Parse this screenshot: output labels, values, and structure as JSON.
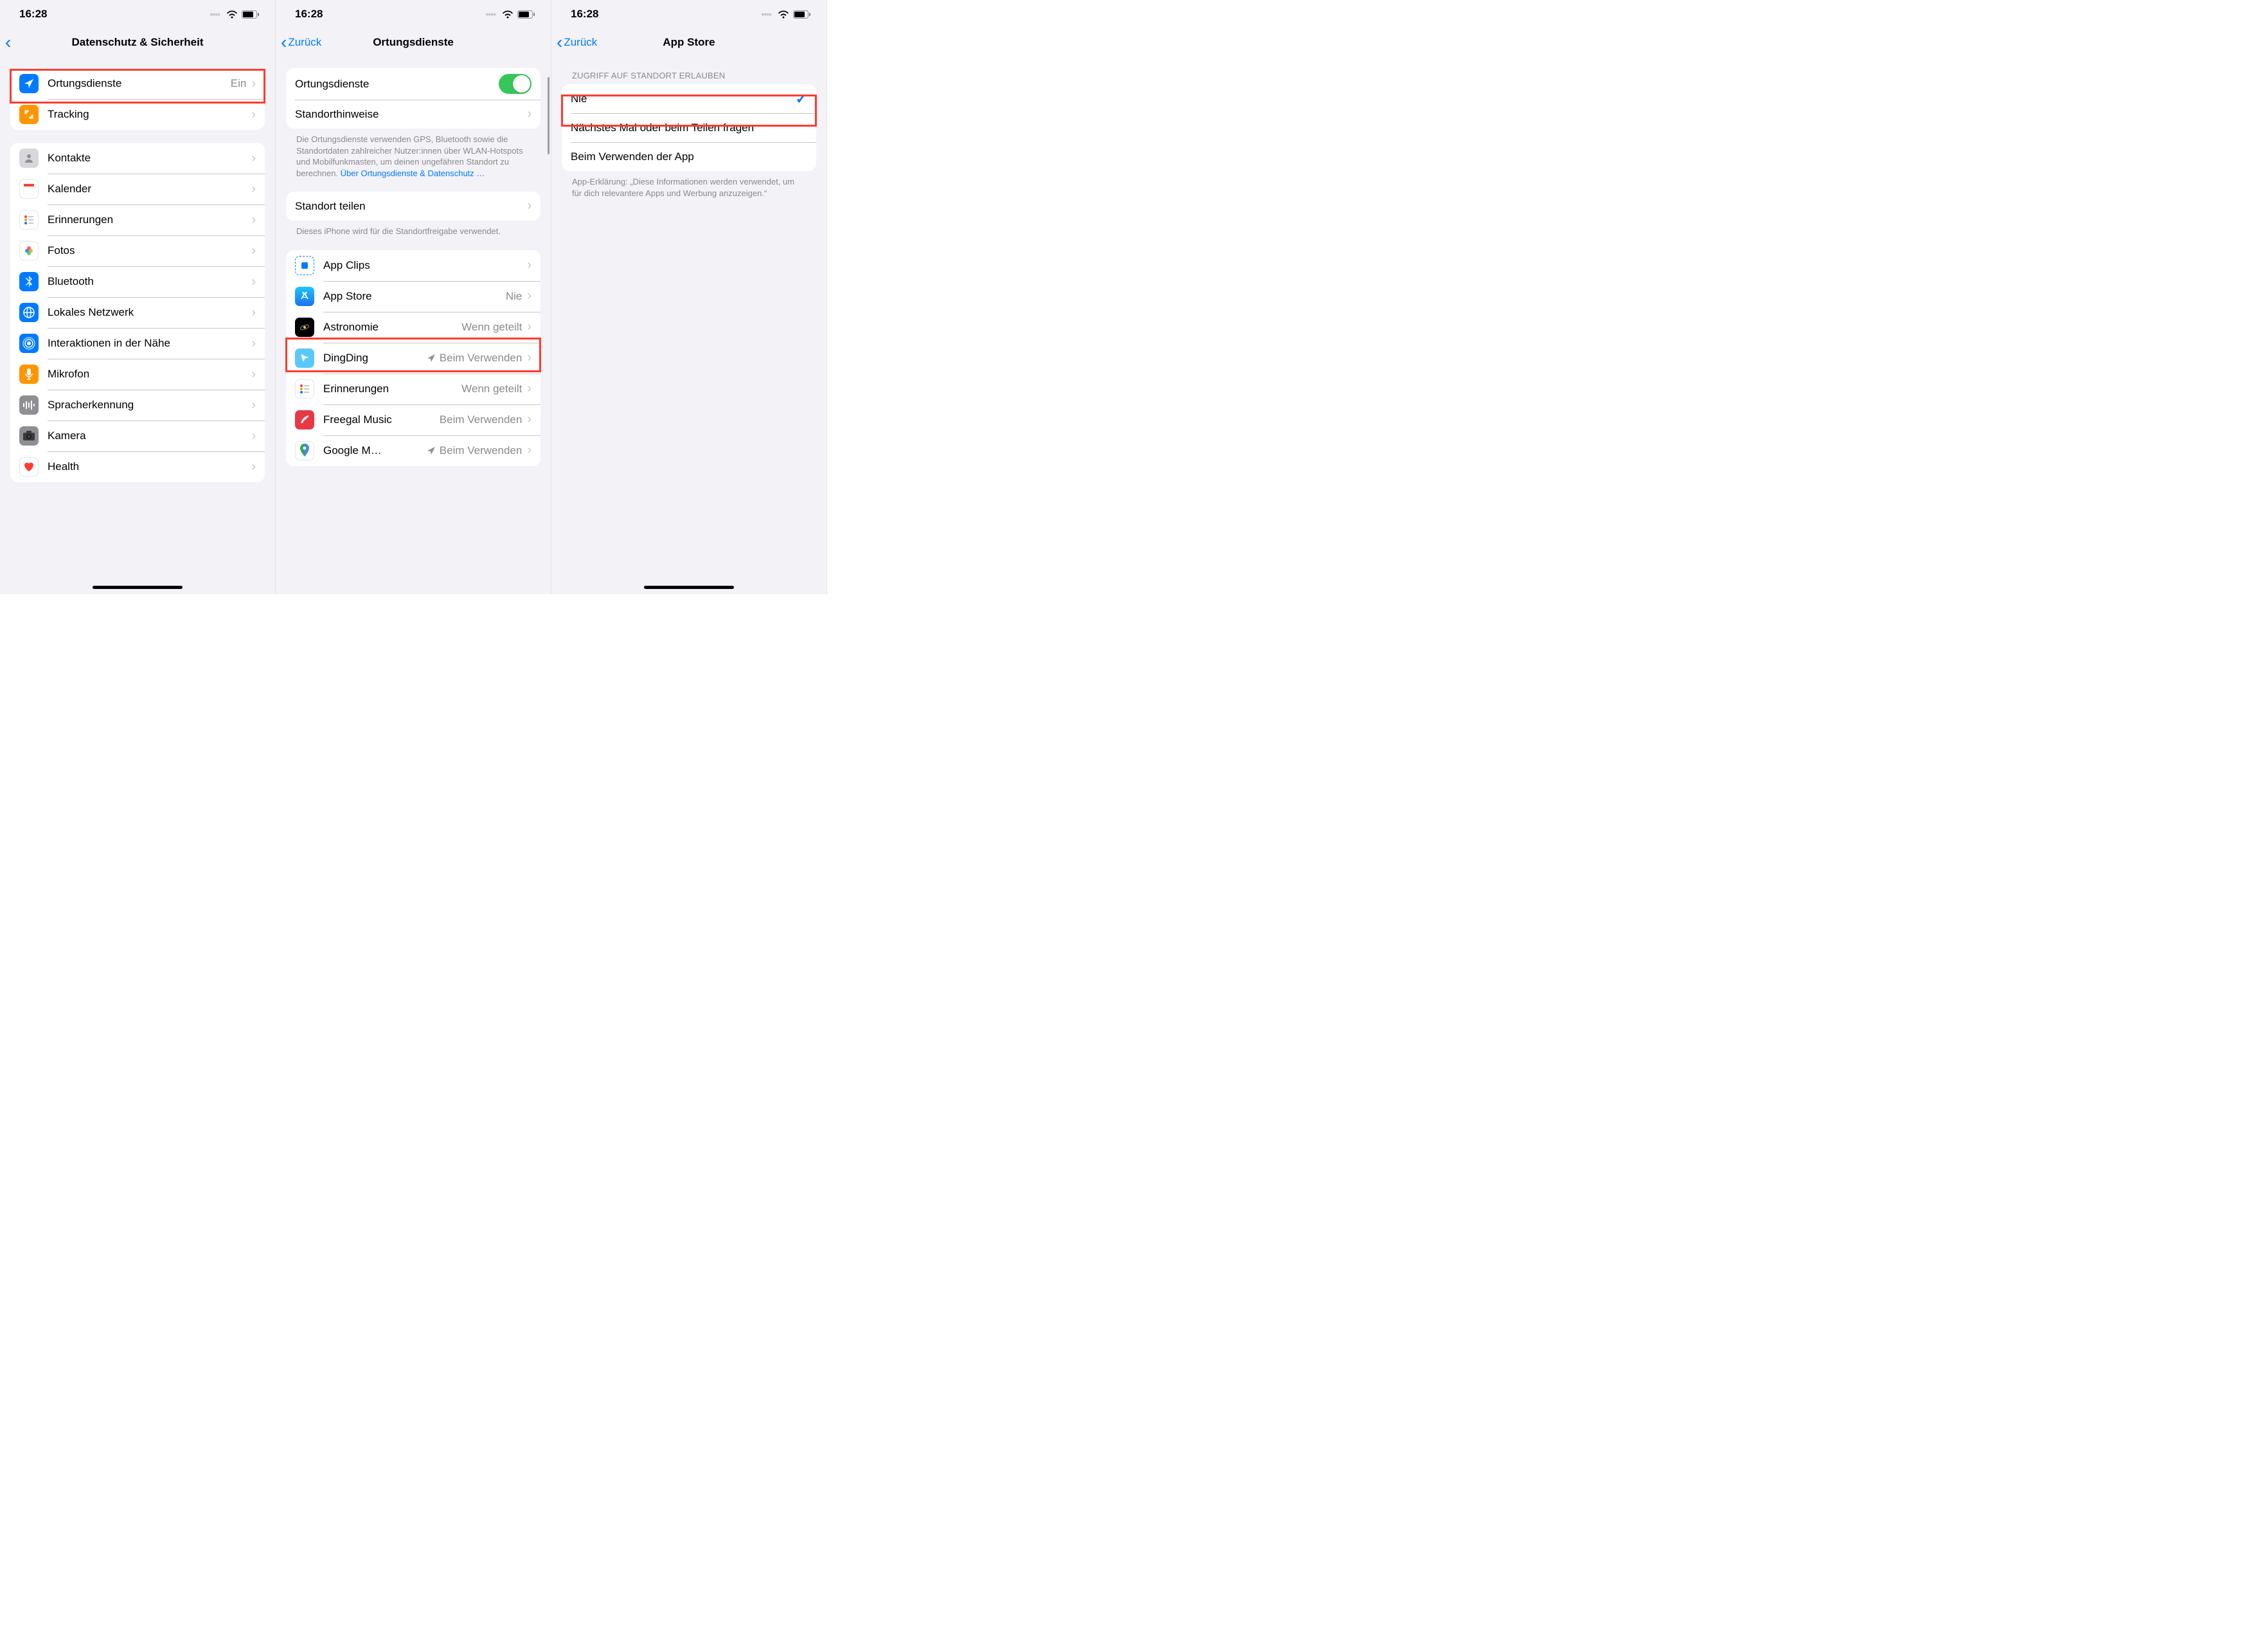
{
  "status": {
    "time": "16:28"
  },
  "screens": [
    {
      "back_label": "",
      "title": "Datenschutz & Sicherheit",
      "groups": [
        {
          "rows": [
            {
              "label": "Ortungsdienste",
              "value": "Ein"
            },
            {
              "label": "Tracking"
            }
          ]
        },
        {
          "rows": [
            {
              "label": "Kontakte"
            },
            {
              "label": "Kalender"
            },
            {
              "label": "Erinnerungen"
            },
            {
              "label": "Fotos"
            },
            {
              "label": "Bluetooth"
            },
            {
              "label": "Lokales Netzwerk"
            },
            {
              "label": "Interaktionen in der Nähe"
            },
            {
              "label": "Mikrofon"
            },
            {
              "label": "Spracherkennung"
            },
            {
              "label": "Kamera"
            },
            {
              "label": "Health"
            }
          ]
        }
      ]
    },
    {
      "back_label": "Zurück",
      "title": "Ortungsdienste",
      "groups": [
        {
          "rows": [
            {
              "label": "Ortungsdienste",
              "toggle": true
            },
            {
              "label": "Standorthinweise"
            }
          ],
          "footer": "Die Ortungsdienste verwenden GPS, Bluetooth sowie die Standortdaten zahlreicher Nutzer:innen über WLAN-Hotspots und Mobilfunkmasten, um deinen ungefähren Standort zu berechnen. ",
          "footer_link": "Über Ortungsdienste & Datenschutz …"
        },
        {
          "rows": [
            {
              "label": "Standort teilen"
            }
          ],
          "footer": "Dieses iPhone wird für die Standortfreigabe verwendet."
        },
        {
          "rows": [
            {
              "label": "App Clips"
            },
            {
              "label": "App Store",
              "value": "Nie"
            },
            {
              "label": "Astronomie",
              "value": "Wenn geteilt"
            },
            {
              "label": "DingDing",
              "value": "Beim Verwenden",
              "status_icon": true
            },
            {
              "label": "Erinnerungen",
              "value": "Wenn geteilt"
            },
            {
              "label": "Freegal Music",
              "value": "Beim Verwenden"
            },
            {
              "label": "Google M…",
              "value": "Beim Verwenden",
              "status_icon": true
            }
          ]
        }
      ]
    },
    {
      "back_label": "Zurück",
      "title": "App Store",
      "section_header": "ZUGRIFF AUF STANDORT ERLAUBEN",
      "options": [
        {
          "label": "Nie",
          "selected": true
        },
        {
          "label": "Nächstes Mal oder beim Teilen fragen"
        },
        {
          "label": "Beim Verwenden der App"
        }
      ],
      "explanation": "App-Erklärung: „Diese Informationen werden verwendet, um für dich relevantere Apps und Werbung anzuzeigen.“"
    }
  ]
}
